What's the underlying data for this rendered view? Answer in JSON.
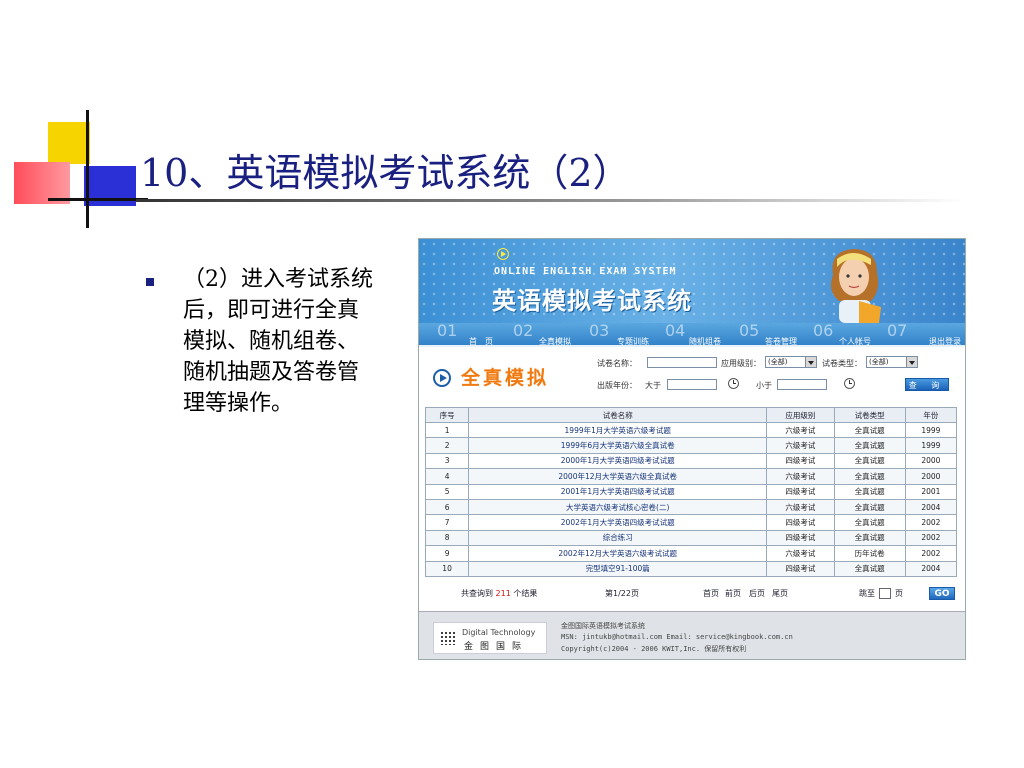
{
  "slide": {
    "title": "10、英语模拟考试系统（2）",
    "bullet": "（2）进入考试系统后，即可进行全真模拟、随机组卷、随机抽题及答卷管理等操作。"
  },
  "app": {
    "banner_en": "ONLINE ENGLISH EXAM SYSTEM",
    "banner_cn": "英语模拟考试系统",
    "nav": [
      {
        "num": "01",
        "label": "首　页"
      },
      {
        "num": "02",
        "label": "全真模拟"
      },
      {
        "num": "03",
        "label": "专题训练"
      },
      {
        "num": "04",
        "label": "随机组卷"
      },
      {
        "num": "05",
        "label": "答卷管理"
      },
      {
        "num": "06",
        "label": "个人帐号"
      },
      {
        "num": "07",
        "label": "退出登录"
      }
    ],
    "section_title": "全真模拟",
    "form": {
      "paper_name_label": "试卷名称：",
      "level_label": "应用级别：",
      "level_value": "(全部)",
      "type_label": "试卷类型：",
      "type_value": "(全部)",
      "year_label": "出版年份：",
      "greater_label": "大于",
      "less_label": "小于",
      "query_label": "查 询"
    },
    "table": {
      "headers": [
        "序号",
        "试卷名称",
        "应用级别",
        "试卷类型",
        "年份"
      ],
      "rows": [
        [
          "1",
          "1999年1月大学英语六级考试题",
          "六级考试",
          "全真试题",
          "1999"
        ],
        [
          "2",
          "1999年6月大学英语六级全真试卷",
          "六级考试",
          "全真试题",
          "1999"
        ],
        [
          "3",
          "2000年1月大学英语四级考试试题",
          "四级考试",
          "全真试题",
          "2000"
        ],
        [
          "4",
          "2000年12月大学英语六级全真试卷",
          "六级考试",
          "全真试题",
          "2000"
        ],
        [
          "5",
          "2001年1月大学英语四级考试试题",
          "四级考试",
          "全真试题",
          "2001"
        ],
        [
          "6",
          "大学英语六级考试核心密卷(二)",
          "六级考试",
          "全真试题",
          "2004"
        ],
        [
          "7",
          "2002年1月大学英语四级考试试题",
          "四级考试",
          "全真试题",
          "2002"
        ],
        [
          "8",
          "综合练习",
          "四级考试",
          "全真试题",
          "2002"
        ],
        [
          "9",
          "2002年12月大学英语六级考试试题",
          "六级考试",
          "历年试卷",
          "2002"
        ],
        [
          "10",
          "完型填空91-100篇",
          "四级考试",
          "全真试题",
          "2004"
        ]
      ]
    },
    "pager": {
      "total_prefix": "共查询到",
      "total_count": "211",
      "total_suffix": "个结果",
      "page_info": "第1/22页",
      "first": "首页",
      "prev": "前页",
      "next": "后页",
      "last": "尾页",
      "jump_label": "跳至",
      "page_unit": "页",
      "go_label": "GO"
    },
    "footer": {
      "logo_en": "Digital Technology",
      "logo_cn": "金图国际",
      "line1": "金图国际英语模拟考试系统",
      "line2": "MSN: jintukb@hotmail.com  Email: service@kingbook.com.cn",
      "line3": "Copyright(c)2004 - 2006 KWIT,Inc. 保留所有权利"
    }
  }
}
